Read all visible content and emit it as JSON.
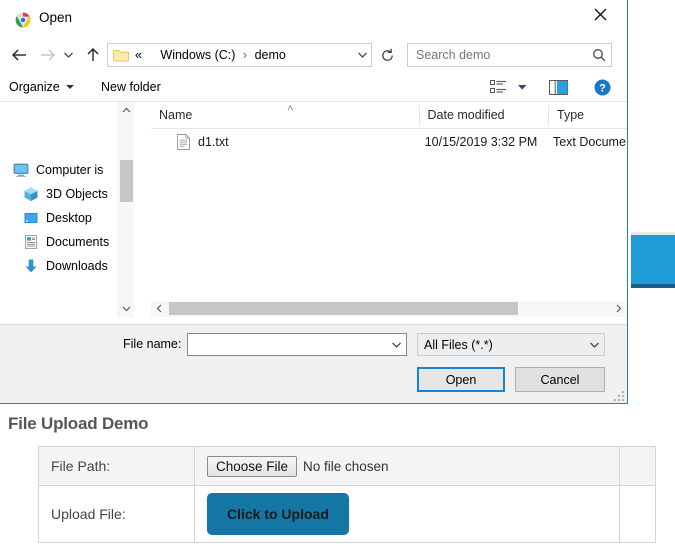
{
  "webpage": {
    "title": "File Upload Demo",
    "table": {
      "rows": [
        {
          "label": "File Path:",
          "button_label": "Choose File",
          "status_text": "No file chosen"
        },
        {
          "label": "Upload File:",
          "button_label": "Click to Upload"
        }
      ]
    },
    "accent_color": "#1476a4",
    "fragment_color": "#1d9cd8"
  },
  "dialog": {
    "title": "Open",
    "title_icon": "chrome-icon",
    "close_label": "✕",
    "nav": {
      "back_icon": "back-arrow-icon",
      "forward_icon": "forward-arrow-icon",
      "recent_icon": "recent-locations-icon",
      "up_icon": "up-arrow-icon",
      "refresh_icon": "refresh-icon"
    },
    "address": {
      "folder_icon": "folder-icon",
      "prefix": "«",
      "crumbs": [
        "Windows (C:)",
        "demo"
      ],
      "separator": "›",
      "dropdown_icon": "chevron-down-icon"
    },
    "search": {
      "placeholder": "Search demo",
      "icon": "search-icon"
    },
    "commandbar": {
      "organize_label": "Organize",
      "newfolder_label": "New folder",
      "view_icon": "view-list-icon",
      "view_caret_icon": "chevron-down-icon",
      "preview_pane_icon": "preview-pane-icon",
      "help_icon": "help-icon"
    },
    "navpane": {
      "items": [
        {
          "label": "Computer is",
          "icon": "computer-icon",
          "indent": false
        },
        {
          "label": "3D Objects",
          "icon": "3d-objects-icon",
          "indent": true
        },
        {
          "label": "Desktop",
          "icon": "desktop-icon",
          "indent": true
        },
        {
          "label": "Documents",
          "icon": "documents-icon",
          "indent": true
        },
        {
          "label": "Downloads",
          "icon": "downloads-icon",
          "indent": true
        }
      ],
      "scrollbar": {
        "up_icon": "chevron-up-icon",
        "down_icon": "chevron-down-icon"
      }
    },
    "filelist": {
      "columns": [
        "Name",
        "Date modified",
        "Type"
      ],
      "sort_indicator": "˄",
      "rows": [
        {
          "icon": "text-document-icon",
          "name": "d1.txt",
          "date_modified": "10/15/2019 3:32 PM",
          "type": "Text Docume"
        }
      ],
      "hscrollbar": {
        "left_icon": "chevron-left-icon",
        "right_icon": "chevron-right-icon"
      }
    },
    "footer": {
      "filename_label": "File name:",
      "filename_value": "",
      "filename_placeholder": "",
      "filename_caret_icon": "chevron-down-icon",
      "filter_value": "All Files (*.*)",
      "filter_caret_icon": "chevron-down-icon",
      "open_label": "Open",
      "cancel_label": "Cancel",
      "resize_grip_icon": "resize-grip-icon"
    }
  }
}
